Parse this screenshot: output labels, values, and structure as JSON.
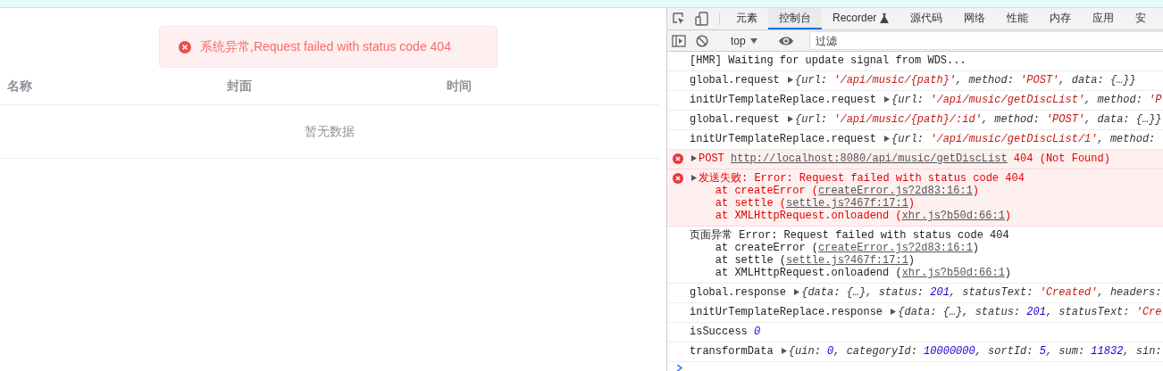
{
  "message": {
    "text": "系统异常,Request failed with status code 404"
  },
  "table": {
    "columns": [
      "名称",
      "封面",
      "时间"
    ],
    "empty_text": "暂无数据"
  },
  "devtools": {
    "tabs": [
      {
        "label": "元素",
        "selected": false
      },
      {
        "label": "控制台",
        "selected": true
      },
      {
        "label": "Recorder",
        "selected": false,
        "flask": true
      },
      {
        "label": "源代码",
        "selected": false
      },
      {
        "label": "网络",
        "selected": false
      },
      {
        "label": "性能",
        "selected": false
      },
      {
        "label": "内存",
        "selected": false
      },
      {
        "label": "应用",
        "selected": false
      },
      {
        "label": "安",
        "selected": false
      }
    ],
    "context": "top",
    "filter": {
      "placeholder": "过滤"
    },
    "logs": [
      {
        "error": false,
        "lines": [
          [
            {
              "kind": "plain",
              "text": "[HMR] Waiting for update signal from WDS..."
            }
          ]
        ]
      },
      {
        "error": false,
        "lines": [
          [
            {
              "kind": "plain",
              "text": "global.request "
            },
            {
              "kind": "toggle"
            },
            {
              "kind": "obj",
              "text": "{url: "
            },
            {
              "kind": "string",
              "text": "'/api/music/{path}'"
            },
            {
              "kind": "obj",
              "text": ", method: "
            },
            {
              "kind": "string",
              "text": "'POST'"
            },
            {
              "kind": "obj",
              "text": ", data: {…}}"
            }
          ]
        ]
      },
      {
        "error": false,
        "lines": [
          [
            {
              "kind": "plain",
              "text": "initUrTemplateReplace.request "
            },
            {
              "kind": "toggle"
            },
            {
              "kind": "obj",
              "text": "{url: "
            },
            {
              "kind": "string",
              "text": "'/api/music/getDiscList'"
            },
            {
              "kind": "obj",
              "text": ", method: "
            },
            {
              "kind": "string",
              "text": "'P"
            }
          ]
        ]
      },
      {
        "error": false,
        "lines": [
          [
            {
              "kind": "plain",
              "text": "global.request "
            },
            {
              "kind": "toggle"
            },
            {
              "kind": "obj",
              "text": "{url: "
            },
            {
              "kind": "string",
              "text": "'/api/music/{path}/:id'"
            },
            {
              "kind": "obj",
              "text": ", method: "
            },
            {
              "kind": "string",
              "text": "'POST'"
            },
            {
              "kind": "obj",
              "text": ", data: {…}}"
            }
          ]
        ]
      },
      {
        "error": false,
        "lines": [
          [
            {
              "kind": "plain",
              "text": "initUrTemplateReplace.request "
            },
            {
              "kind": "toggle"
            },
            {
              "kind": "obj",
              "text": "{url: "
            },
            {
              "kind": "string",
              "text": "'/api/music/getDiscList/1'"
            },
            {
              "kind": "obj",
              "text": ", method:"
            }
          ]
        ]
      },
      {
        "error": true,
        "lines": [
          [
            {
              "kind": "toggle"
            },
            {
              "kind": "plain",
              "text": "POST "
            },
            {
              "kind": "link",
              "text": "http://localhost:8080/api/music/getDiscList"
            },
            {
              "kind": "plain",
              "text": " 404 (Not Found)"
            }
          ]
        ]
      },
      {
        "error": true,
        "lines": [
          [
            {
              "kind": "toggle"
            },
            {
              "kind": "plain",
              "text": "发送失败: Error: Request failed with status code 404"
            }
          ],
          [
            {
              "kind": "plain",
              "text": "    at createError ("
            },
            {
              "kind": "link",
              "text": "createError.js?2d83:16:1"
            },
            {
              "kind": "plain",
              "text": ")"
            }
          ],
          [
            {
              "kind": "plain",
              "text": "    at settle ("
            },
            {
              "kind": "link",
              "text": "settle.js?467f:17:1"
            },
            {
              "kind": "plain",
              "text": ")"
            }
          ],
          [
            {
              "kind": "plain",
              "text": "    at XMLHttpRequest.onloadend ("
            },
            {
              "kind": "link",
              "text": "xhr.js?b50d:66:1"
            },
            {
              "kind": "plain",
              "text": ")"
            }
          ]
        ]
      },
      {
        "error": false,
        "lines": [
          [
            {
              "kind": "plain",
              "text": "页面异常 Error: Request failed with status code 404"
            }
          ],
          [
            {
              "kind": "plain",
              "text": "    at createError ("
            },
            {
              "kind": "link",
              "text": "createError.js?2d83:16:1"
            },
            {
              "kind": "plain",
              "text": ")"
            }
          ],
          [
            {
              "kind": "plain",
              "text": "    at settle ("
            },
            {
              "kind": "link",
              "text": "settle.js?467f:17:1"
            },
            {
              "kind": "plain",
              "text": ")"
            }
          ],
          [
            {
              "kind": "plain",
              "text": "    at XMLHttpRequest.onloadend ("
            },
            {
              "kind": "link",
              "text": "xhr.js?b50d:66:1"
            },
            {
              "kind": "plain",
              "text": ")"
            }
          ]
        ]
      },
      {
        "error": false,
        "lines": [
          [
            {
              "kind": "plain",
              "text": "global.response "
            },
            {
              "kind": "toggle"
            },
            {
              "kind": "obj",
              "text": "{data: {…}, status: "
            },
            {
              "kind": "number",
              "text": "201"
            },
            {
              "kind": "obj",
              "text": ", statusText: "
            },
            {
              "kind": "string",
              "text": "'Created'"
            },
            {
              "kind": "obj",
              "text": ", headers:"
            }
          ]
        ]
      },
      {
        "error": false,
        "lines": [
          [
            {
              "kind": "plain",
              "text": "initUrTemplateReplace.response "
            },
            {
              "kind": "toggle"
            },
            {
              "kind": "obj",
              "text": "{data: {…}, status: "
            },
            {
              "kind": "number",
              "text": "201"
            },
            {
              "kind": "obj",
              "text": ", statusText: "
            },
            {
              "kind": "string",
              "text": "'Cre"
            }
          ]
        ]
      },
      {
        "error": false,
        "lines": [
          [
            {
              "kind": "plain",
              "text": "isSuccess "
            },
            {
              "kind": "number",
              "text": "0"
            }
          ]
        ]
      },
      {
        "error": false,
        "lines": [
          [
            {
              "kind": "plain",
              "text": "transformData "
            },
            {
              "kind": "toggle"
            },
            {
              "kind": "obj",
              "text": "{uin: "
            },
            {
              "kind": "number",
              "text": "0"
            },
            {
              "kind": "obj",
              "text": ", categoryId: "
            },
            {
              "kind": "number",
              "text": "10000000"
            },
            {
              "kind": "obj",
              "text": ", sortId: "
            },
            {
              "kind": "number",
              "text": "5"
            },
            {
              "kind": "obj",
              "text": ", sum: "
            },
            {
              "kind": "number",
              "text": "11832"
            },
            {
              "kind": "obj",
              "text": ", sin:"
            }
          ]
        ]
      }
    ]
  }
}
